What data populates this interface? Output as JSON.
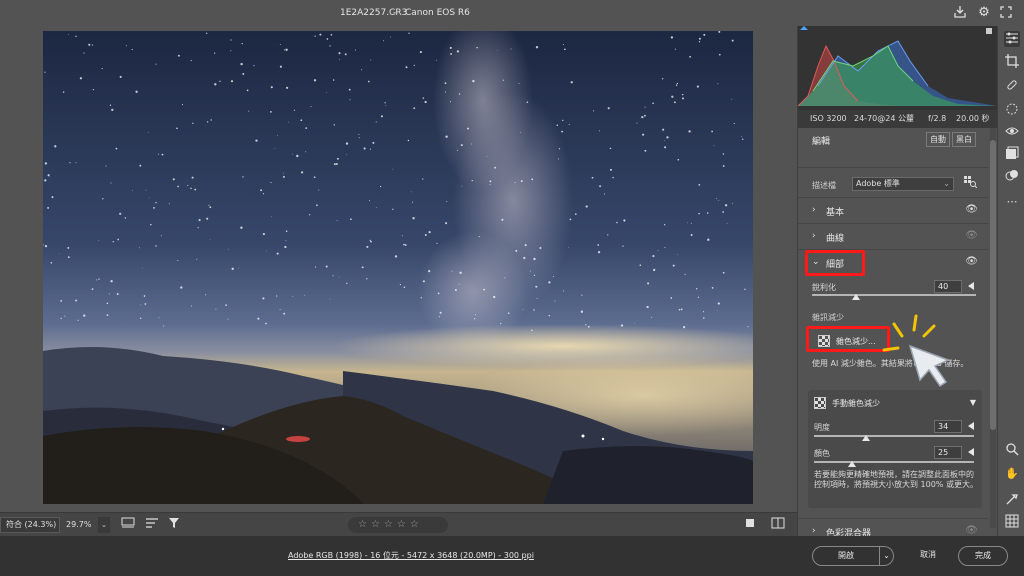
{
  "window": {
    "file_name": "1E2A2257.CR3",
    "separator": "-",
    "camera": "Canon EOS R6"
  },
  "titlebar_icons": [
    "save-icon",
    "gear-icon",
    "fullscreen-icon"
  ],
  "exif": {
    "iso": "ISO 3200",
    "lens": "24-70@24 公釐",
    "aperture": "f/2.8",
    "shutter": "20.00 秒"
  },
  "edit": {
    "title": "編輯",
    "auto_label": "自動",
    "bw_label": "黑白"
  },
  "profile": {
    "label": "描述檔",
    "value": "Adobe 標準"
  },
  "sections": {
    "basic": "基本",
    "curve": "曲線",
    "detail": "細部",
    "color_mixer": "色彩混合器"
  },
  "detail": {
    "sharpen_label": "銳利化",
    "sharpen_value": "40",
    "noise_reduction_label": "雜訊減少",
    "denoise_label": "雜色減少...",
    "ai_desc": "使用 AI 減少雜色。其結果將以 DNG 儲存。",
    "manual_title": "手動雜色減少",
    "luminance_label": "明度",
    "luminance_value": "34",
    "color_label": "顏色",
    "color_value": "25",
    "hint": "若要能夠更精確地預視，請在調整此面板中的控制項時，將預視大小放大到 100% 或更大。"
  },
  "bottombar": {
    "fit_label": "符合 (24.3%)",
    "zoom_label": "29.7%"
  },
  "status": {
    "workflow": "Adobe RGB (1998) - 16 位元 - 5472 x 3648 (20.0MP) - 300 ppi",
    "open_label": "開啟",
    "cancel_label": "取消",
    "done_label": "完成"
  },
  "colors": {
    "highlight_box": "#ff1a1a",
    "panel_bg": "#535353",
    "status_bg": "#323232"
  }
}
